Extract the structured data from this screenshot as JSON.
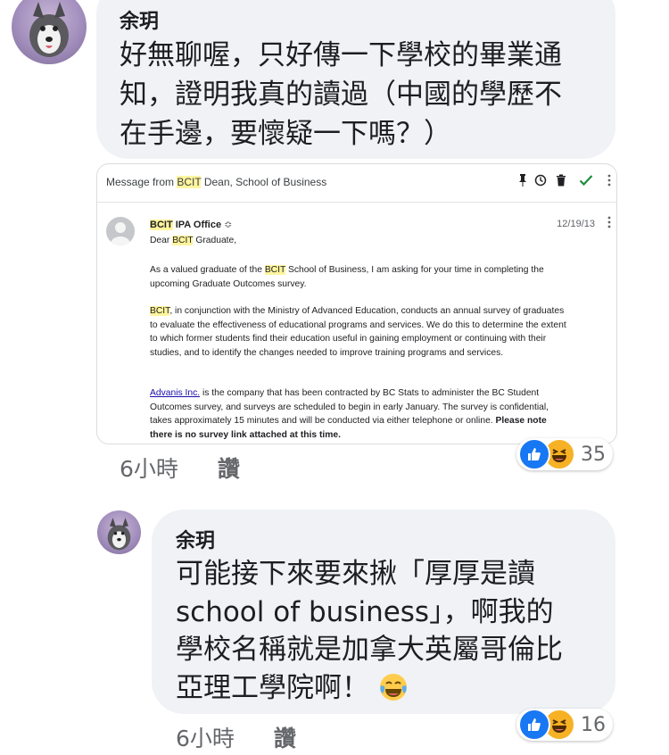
{
  "comment1": {
    "author": "余玥",
    "text": "好無聊喔，只好傳一下學校的畢業通知，證明我真的讀過（中國的學歷不在手邊，要懷疑一下嗎？）",
    "lines": [
      "好無聊喔，只好傳一下學校的畢業通",
      "知，證明我真的讀過（中國的學歷不",
      "在手邊，要懷疑一下嗎？）"
    ],
    "time": "6小時",
    "like_label": "讚",
    "reaction_count": "35",
    "reactions": [
      "like-icon",
      "haha-icon"
    ]
  },
  "email": {
    "subject_pre": "Message from ",
    "subject_hl": "BCIT",
    "subject_post": " Dean, School of Business",
    "sender_hl": "BCIT",
    "sender_rest": " IPA Office",
    "sender_caret": "≎",
    "date": "12/19/13",
    "greeting_pre": "Dear ",
    "greeting_hl": "BCIT",
    "greeting_post": " Graduate,",
    "p1_pre": "As a valued graduate of the ",
    "p1_hl": "BCIT",
    "p1_post": " School of Business, I am asking for your time in completing the upcoming Graduate Outcomes survey.",
    "p2_hl": "BCIT",
    "p2_post": ", in conjunction with the Ministry of Advanced Education, conducts an annual survey of graduates to evaluate the effectiveness of educational programs and services.  We do this to determine the extent to which former students find their education useful in gaining employment or continuing with their studies, and to identify the changes needed to improve training programs and services.",
    "p3_link": "Advanis Inc.",
    "p3_mid": " is the company that has been contracted by BC Stats to administer the BC Student Outcomes survey, and surveys are scheduled to begin in early January.  The survey is confidential, takes approximately 15 minutes and will be conducted via either telephone or online.  ",
    "p3_bold": "Please note there is no survey link attached at this time."
  },
  "comment2": {
    "author": "余玥",
    "lines": [
      "可能接下來要來揪「厚厚是讀",
      "school of business」，啊我的",
      "學校名稱就是加拿大英屬哥倫比",
      "亞理工學院啊！"
    ],
    "emoji": "tears-of-joy-icon",
    "time": "6小時",
    "like_label": "讚",
    "reaction_count": "16",
    "reactions": [
      "like-icon",
      "haha-icon"
    ]
  },
  "colors": {
    "like_blue": "#1877f2",
    "haha_yellow": "#f7b125",
    "bubble": "#f0f2f5",
    "highlight": "#fff59d"
  }
}
